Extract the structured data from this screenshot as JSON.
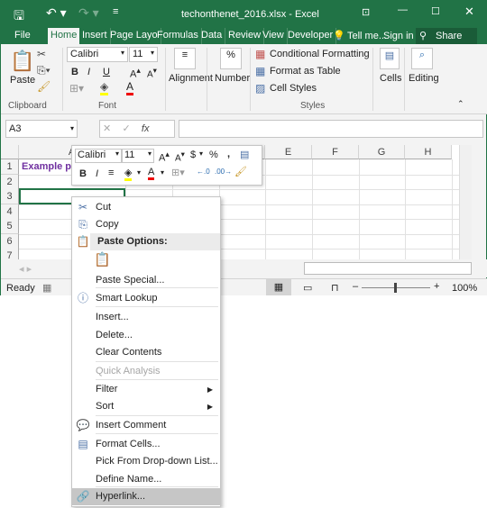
{
  "title": "techonthenet_2016.xlsx - Excel",
  "tabs": [
    "File",
    "Home",
    "Insert",
    "Page Layo",
    "Formulas",
    "Data",
    "Review",
    "View",
    "Developer"
  ],
  "tell_me": "Tell me...",
  "sign_in": "Sign in",
  "share": "Share",
  "ribbon": {
    "paste": "Paste",
    "font_name": "Calibri",
    "font_size": "11",
    "bold": "B",
    "italic": "I",
    "underline": "U",
    "alignment": "Alignment",
    "number": "Number",
    "percent": "%",
    "cond_format": "Conditional Formatting",
    "format_table": "Format as Table",
    "cell_styles": "Cell Styles",
    "cells": "Cells",
    "editing": "Editing",
    "groups": {
      "clipboard": "Clipboard",
      "font": "Font",
      "styles": "Styles"
    }
  },
  "formula_bar": {
    "name_box": "A3",
    "fx": "fx",
    "value": ""
  },
  "columns": [
    "A",
    "B",
    "C",
    "D",
    "E",
    "F",
    "G",
    "H"
  ],
  "rows": [
    "1",
    "2",
    "3",
    "4",
    "5",
    "6",
    "7"
  ],
  "cells": {
    "A1": "Example pr"
  },
  "mini_toolbar": {
    "font": "Calibri",
    "size": "11",
    "currency": "$",
    "percent": "%",
    "comma": ",",
    "bold": "B",
    "italic": "I"
  },
  "status": {
    "ready": "Ready",
    "zoom": "100%"
  },
  "context_menu": [
    {
      "label": "Cut",
      "icon": "scissors-icon"
    },
    {
      "label": "Copy",
      "icon": "copy-icon"
    },
    {
      "label": "Paste Options:",
      "icon": "paste-icon",
      "header": true
    },
    {
      "label": "Paste Special..."
    },
    {
      "label": "Smart Lookup",
      "icon": "smart-lookup-icon"
    },
    {
      "label": "Insert..."
    },
    {
      "label": "Delete..."
    },
    {
      "label": "Clear Contents"
    },
    {
      "label": "Quick Analysis",
      "disabled": true
    },
    {
      "label": "Filter",
      "submenu": true
    },
    {
      "label": "Sort",
      "submenu": true
    },
    {
      "label": "Insert Comment",
      "icon": "comment-icon"
    },
    {
      "label": "Format Cells...",
      "icon": "format-cells-icon"
    },
    {
      "label": "Pick From Drop-down List..."
    },
    {
      "label": "Define Name..."
    },
    {
      "label": "Hyperlink...",
      "icon": "hyperlink-icon",
      "highlighted": true
    }
  ],
  "colors": {
    "excel_green": "#217346",
    "accent_text": "#7030a0",
    "highlight": "#c6c6c6"
  }
}
